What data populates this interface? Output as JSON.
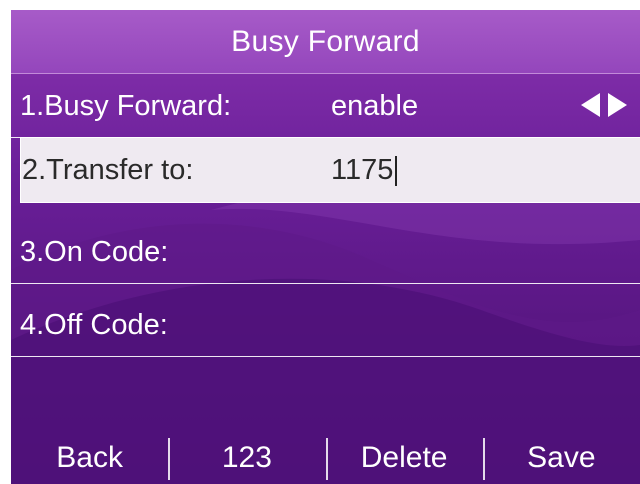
{
  "header": {
    "title": "Busy Forward"
  },
  "fields": [
    {
      "label": "1.Busy Forward:",
      "value": "enable",
      "control": "left-right-arrows-icon"
    },
    {
      "label": "2.Transfer to:",
      "value": "1175",
      "selected": true
    },
    {
      "label": "3.On Code:",
      "value": ""
    },
    {
      "label": "4.Off Code:",
      "value": ""
    }
  ],
  "softkeys": [
    {
      "label": "Back"
    },
    {
      "label": "123"
    },
    {
      "label": "Delete"
    },
    {
      "label": "Save"
    }
  ],
  "colors": {
    "background": "#6a1f99",
    "title_bar": "#9446bc",
    "selected_row": "#efeaf1",
    "text": "#ffffff"
  }
}
